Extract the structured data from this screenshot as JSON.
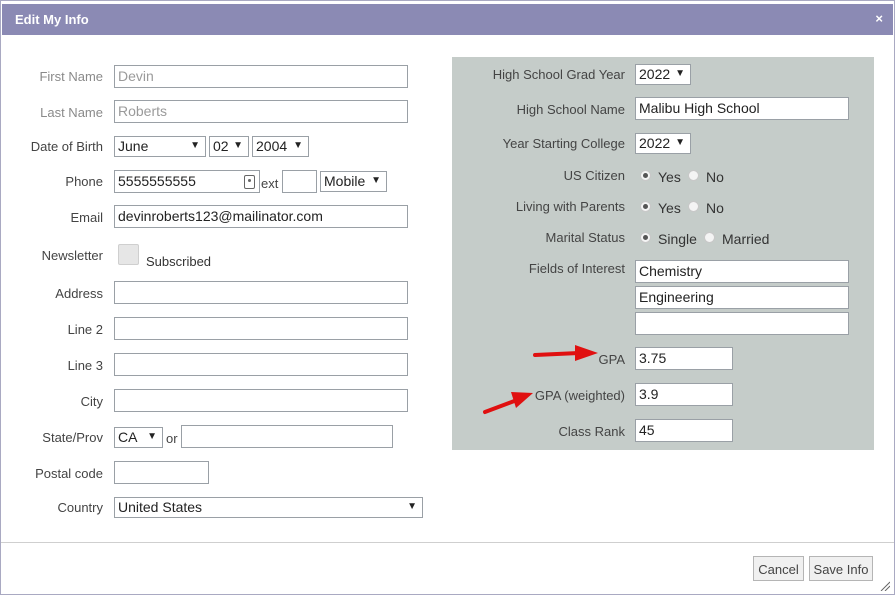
{
  "dialog": {
    "title": "Edit My Info",
    "close_icon": "×"
  },
  "left": {
    "first_name": {
      "label": "First Name",
      "value": "Devin"
    },
    "last_name": {
      "label": "Last Name",
      "value": "Roberts"
    },
    "dob": {
      "label": "Date of Birth",
      "month": "June",
      "day": "02",
      "year": "2004"
    },
    "phone": {
      "label": "Phone",
      "value": "5555555555",
      "ext_label": "ext",
      "ext_value": "",
      "type": "Mobile"
    },
    "email": {
      "label": "Email",
      "value": "devinroberts123@mailinator.com"
    },
    "newsletter": {
      "label": "Newsletter",
      "text": "Subscribed",
      "checked": false
    },
    "address": {
      "label": "Address",
      "value": ""
    },
    "line2": {
      "label": "Line 2",
      "value": ""
    },
    "line3": {
      "label": "Line 3",
      "value": ""
    },
    "city": {
      "label": "City",
      "value": ""
    },
    "state": {
      "label": "State/Prov",
      "value": "CA",
      "or_label": "or",
      "other": ""
    },
    "postal": {
      "label": "Postal code",
      "value": ""
    },
    "country": {
      "label": "Country",
      "value": "United States"
    }
  },
  "right": {
    "hs_grad_year": {
      "label": "High School Grad Year",
      "value": "2022"
    },
    "hs_name": {
      "label": "High School Name",
      "value": "Malibu High School"
    },
    "college_year": {
      "label": "Year Starting College",
      "value": "2022"
    },
    "us_citizen": {
      "label": "US Citizen",
      "opt1": "Yes",
      "opt2": "No",
      "selected": "Yes"
    },
    "living_parents": {
      "label": "Living with Parents",
      "opt1": "Yes",
      "opt2": "No",
      "selected": "Yes"
    },
    "marital": {
      "label": "Marital Status",
      "opt1": "Single",
      "opt2": "Married",
      "selected": "Single"
    },
    "fields_interest": {
      "label": "Fields of Interest",
      "values": [
        "Chemistry",
        "Engineering",
        ""
      ]
    },
    "gpa": {
      "label": "GPA",
      "value": "3.75"
    },
    "gpa_weighted": {
      "label": "GPA (weighted)",
      "value": "3.9"
    },
    "class_rank": {
      "label": "Class Rank",
      "value": "45"
    }
  },
  "buttons": {
    "cancel": "Cancel",
    "save": "Save Info"
  },
  "colors": {
    "titlebar": "#8b8ab4",
    "panel": "#c5ccc9",
    "annotation_arrow": "#e01010"
  },
  "dropdown_arrow": "▼"
}
